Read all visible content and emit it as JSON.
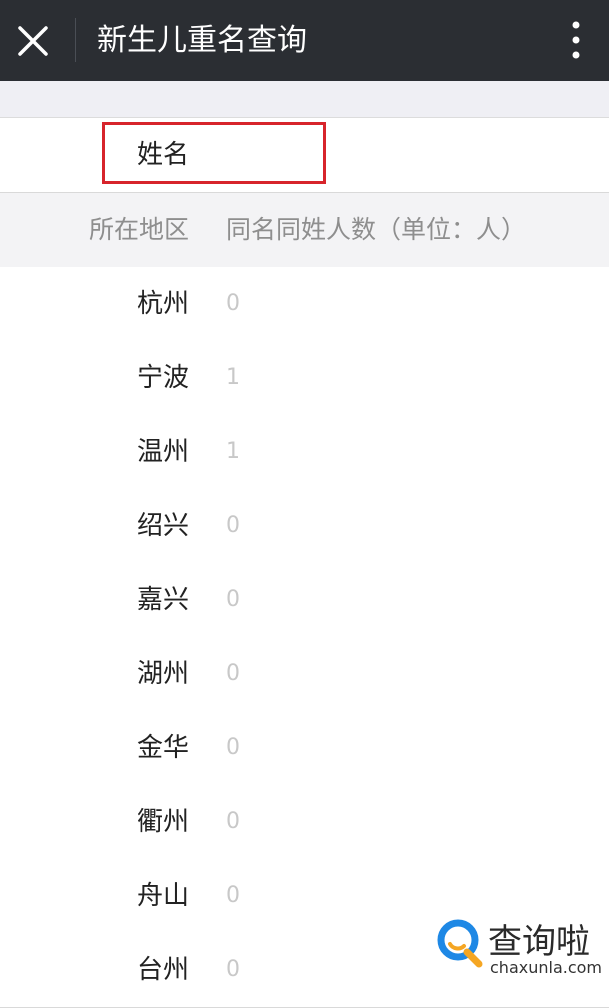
{
  "header": {
    "title": "新生儿重名查询",
    "close_icon": "close-icon",
    "more_icon": "more-vertical-icon"
  },
  "name_row": {
    "label": "姓名",
    "value": ""
  },
  "table": {
    "columns": [
      "所在地区",
      "同名同姓人数（单位：人）"
    ],
    "rows": [
      {
        "region": "杭州",
        "count": "0"
      },
      {
        "region": "宁波",
        "count": "1"
      },
      {
        "region": "温州",
        "count": "1"
      },
      {
        "region": "绍兴",
        "count": "0"
      },
      {
        "region": "嘉兴",
        "count": "0"
      },
      {
        "region": "湖州",
        "count": "0"
      },
      {
        "region": "金华",
        "count": "0"
      },
      {
        "region": "衢州",
        "count": "0"
      },
      {
        "region": "舟山",
        "count": "0"
      },
      {
        "region": "台州",
        "count": "0"
      }
    ]
  },
  "watermark": {
    "logo_text": "查询啦",
    "url": "chaxunla.com"
  },
  "colors": {
    "titlebar": "#2b2e33",
    "highlight": "#d7242b",
    "logo_blue": "#1e88e5",
    "logo_orange": "#f5a623"
  }
}
